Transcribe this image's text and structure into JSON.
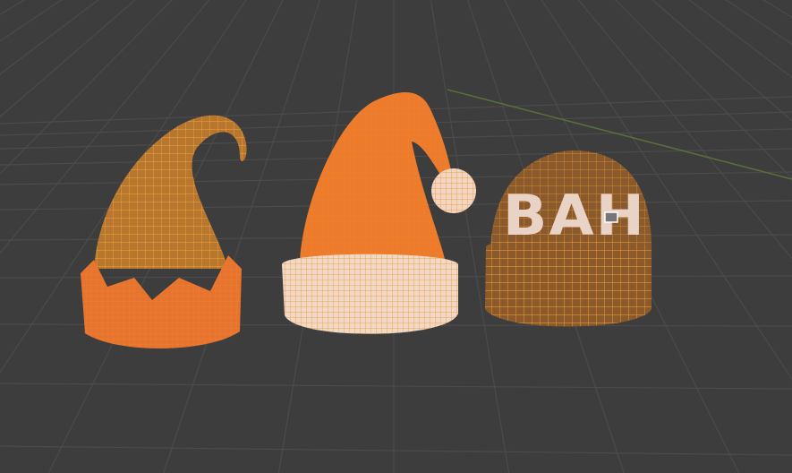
{
  "viewport": {
    "background": "#3d3d3d",
    "grid_color": "#4a4a4a",
    "x_axis_color": "#5a7a3a",
    "selection_color": "#f0902a"
  },
  "objects": [
    {
      "name": "elf-hat",
      "fill": "#e8732f"
    },
    {
      "name": "santa-hat",
      "fill": "#ee7a2c"
    },
    {
      "name": "beanie",
      "fill": "#8a5a2c",
      "knit_text": "BAH"
    }
  ]
}
